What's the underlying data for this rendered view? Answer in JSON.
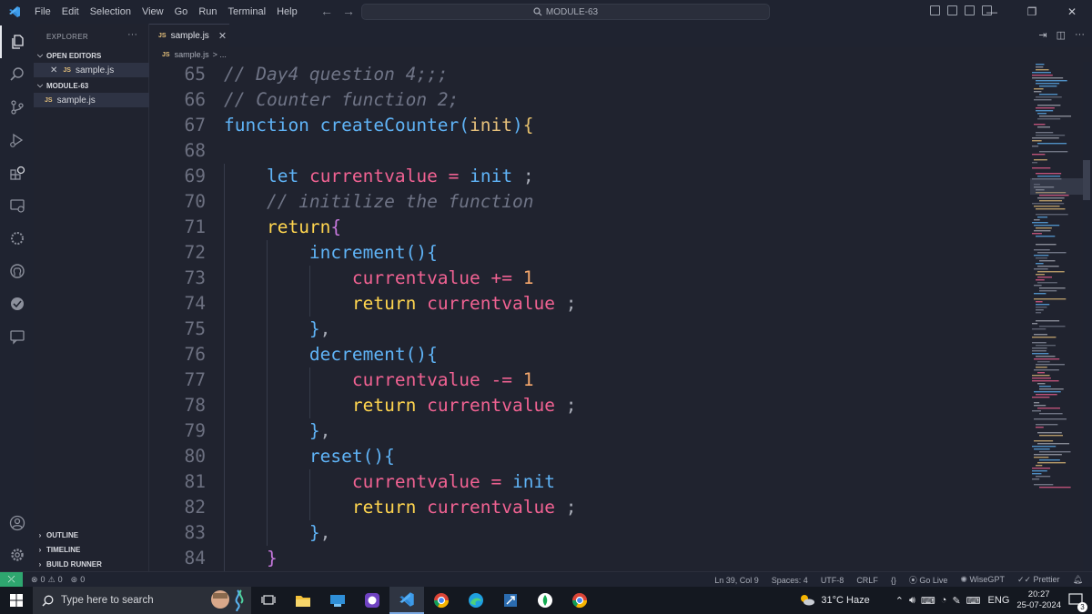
{
  "titlebar": {
    "menu": [
      "File",
      "Edit",
      "Selection",
      "View",
      "Go",
      "Run",
      "Terminal",
      "Help"
    ],
    "command_center": "MODULE-63"
  },
  "sidebar": {
    "title": "EXPLORER",
    "open_editors_label": "OPEN EDITORS",
    "open_file": "sample.js",
    "folder_label": "MODULE-63",
    "folder_file": "sample.js",
    "outline_label": "OUTLINE",
    "timeline_label": "TIMELINE",
    "build_runner_label": "BUILD RUNNER",
    "js_badge": "JS"
  },
  "tab": {
    "label": "sample.js",
    "badge": "JS"
  },
  "breadcrumb": {
    "file": "sample.js",
    "rest": "> ..."
  },
  "editor": {
    "lines": [
      {
        "n": "65",
        "text": "// Day4 question 4;;;"
      },
      {
        "n": "66",
        "text": "// Counter function 2;"
      },
      {
        "n": "67",
        "text": "function createCounter(init){"
      },
      {
        "n": "68",
        "text": ""
      },
      {
        "n": "69",
        "text": "    let currentvalue = init ;"
      },
      {
        "n": "70",
        "text": "    // initilize the function"
      },
      {
        "n": "71",
        "text": "    return{"
      },
      {
        "n": "72",
        "text": "        increment(){"
      },
      {
        "n": "73",
        "text": "            currentvalue += 1"
      },
      {
        "n": "74",
        "text": "            return currentvalue ;"
      },
      {
        "n": "75",
        "text": "        },"
      },
      {
        "n": "76",
        "text": "        decrement(){"
      },
      {
        "n": "77",
        "text": "            currentvalue -= 1"
      },
      {
        "n": "78",
        "text": "            return currentvalue ;"
      },
      {
        "n": "79",
        "text": "        },"
      },
      {
        "n": "80",
        "text": "        reset(){"
      },
      {
        "n": "81",
        "text": "            currentvalue = init"
      },
      {
        "n": "82",
        "text": "            return currentvalue ;"
      },
      {
        "n": "83",
        "text": "        },"
      },
      {
        "n": "84",
        "text": "    }"
      }
    ]
  },
  "statusbar": {
    "errors": "0",
    "warnings": "0",
    "ports": "0",
    "position": "Ln 39, Col 9",
    "spaces": "Spaces: 4",
    "encoding": "UTF-8",
    "eol": "CRLF",
    "golive": "Go Live",
    "wisegpt": "WiseGPT",
    "prettier": "Prettier"
  },
  "taskbar": {
    "search_placeholder": "Type here to search",
    "weather": "31°C  Haze",
    "lang": "ENG",
    "time": "20:27",
    "date": "25-07-2024",
    "notifications": "3"
  },
  "colors": {
    "background": "#20232f",
    "keyword": "#5fb3f6",
    "variable": "#f06292",
    "number": "#f5a76c",
    "comment": "#6f7486",
    "accent_remote": "#2ea66f"
  }
}
